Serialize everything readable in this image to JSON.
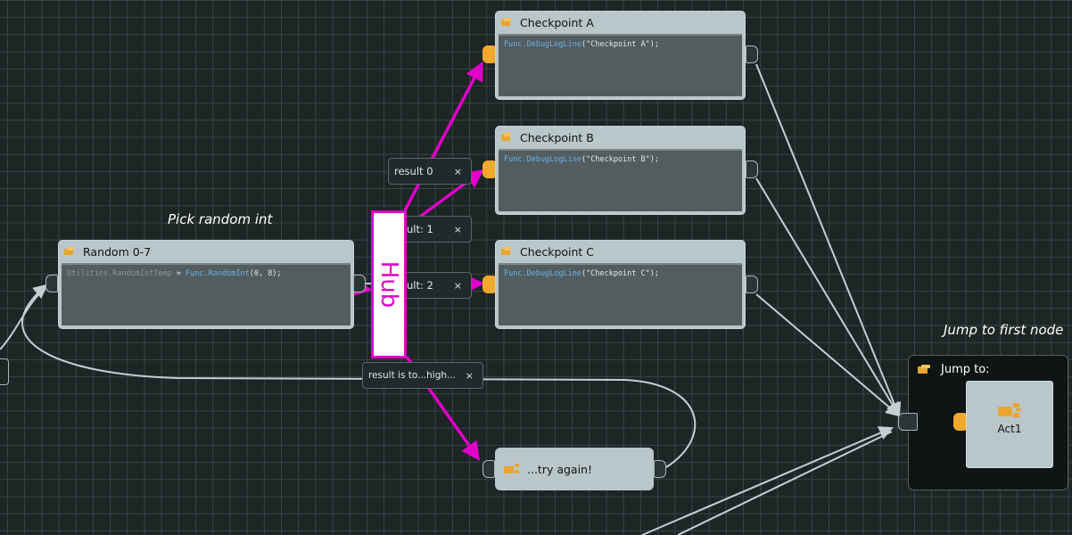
{
  "labels": {
    "pick_random": "Pick random int",
    "jump_to_first": "Jump to first node"
  },
  "nodes": {
    "random": {
      "title": "Random 0-7",
      "code_a": "Utilities.RandomIntTemp",
      "code_eq": " = ",
      "code_fn": "Func.RandomInt",
      "code_args": "(0, 8);"
    },
    "checkpoint_a": {
      "title": "Checkpoint A",
      "code_fn": "Func.DebugLogLine",
      "code_args": "(\"Checkpoint A\");"
    },
    "checkpoint_b": {
      "title": "Checkpoint B",
      "code_fn": "Func.DebugLogLine",
      "code_args": "(\"Checkpoint B\");"
    },
    "checkpoint_c": {
      "title": "Checkpoint C",
      "code_fn": "Func.DebugLogLine",
      "code_args": "(\"Checkpoint C\");"
    },
    "try_again": {
      "title": "...try again!",
      "icon": "jump-icon"
    },
    "jump": {
      "header": "Jump to:",
      "target": "Act1"
    }
  },
  "conditions": [
    {
      "label": "result 0",
      "close": "×"
    },
    {
      "label": "ult: 1",
      "close": "×"
    },
    {
      "label": "ult: 2",
      "close": "×"
    },
    {
      "label": "result is to...high...",
      "close": "×"
    }
  ],
  "annotation": {
    "hub": "Hub",
    "color": "#e000c8"
  },
  "colors": {
    "background": "#1d2525",
    "node": "#b9c7cb",
    "port_in": "#f2a92b",
    "wire": "#c3d0d2",
    "annotation": "#e000c8"
  }
}
